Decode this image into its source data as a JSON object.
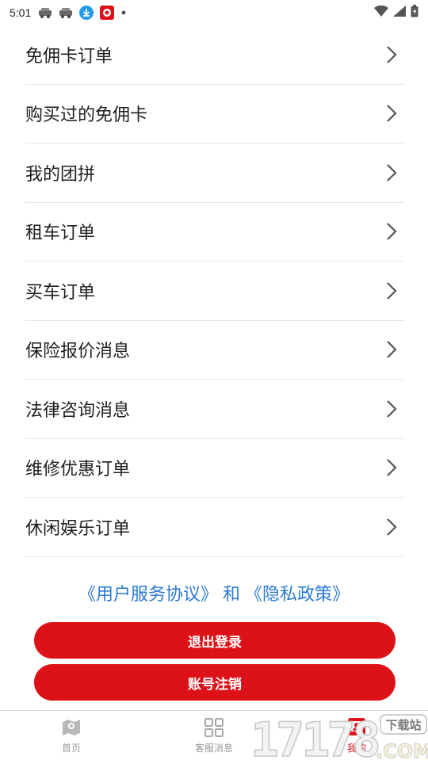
{
  "status_bar": {
    "time": "5:01"
  },
  "menu": {
    "items": [
      {
        "label": "免佣卡订单"
      },
      {
        "label": "购买过的免佣卡"
      },
      {
        "label": "我的团拼"
      },
      {
        "label": "租车订单"
      },
      {
        "label": "买车订单"
      },
      {
        "label": "保险报价消息"
      },
      {
        "label": "法律咨询消息"
      },
      {
        "label": "维修优惠订单"
      },
      {
        "label": "休闲娱乐订单"
      }
    ]
  },
  "agreement": {
    "user_agreement": "《用户服务协议》",
    "joiner": "和",
    "privacy_policy": "《隐私政策》"
  },
  "buttons": {
    "logout": "退出登录",
    "cancel_account": "账号注销"
  },
  "tabbar": {
    "tabs": [
      {
        "label": "首页",
        "icon": "home-map-icon"
      },
      {
        "label": "客服消息",
        "icon": "grid-icon"
      },
      {
        "label": "我的",
        "icon": "profile-icon"
      }
    ]
  },
  "watermark": {
    "number": "17178",
    "badge": "下载站",
    "domain": ".COM"
  },
  "colors": {
    "accent": "#dd1118",
    "link": "#2b7bd6"
  }
}
